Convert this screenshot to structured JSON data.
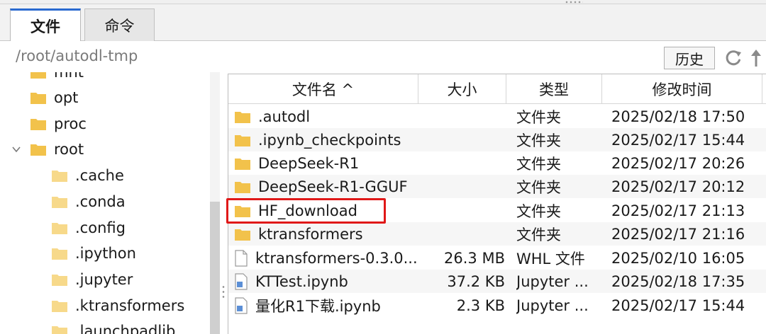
{
  "tabs": [
    {
      "label": "文件",
      "active": true
    },
    {
      "label": "命令",
      "active": false
    }
  ],
  "path": "/root/autodl-tmp",
  "history_label": "历史",
  "icons": {
    "refresh": "refresh-icon",
    "upload": "upload-arrow-icon",
    "folder": "folder-icon",
    "file": "file-icon",
    "notebook": "notebook-file-icon"
  },
  "colors": {
    "folder": "#f2c24b",
    "highlight": "#e01818",
    "accent": "#2a6ad0"
  },
  "tree": [
    {
      "label": "mnt",
      "level": 0
    },
    {
      "label": "opt",
      "level": 0
    },
    {
      "label": "proc",
      "level": 0
    },
    {
      "label": "root",
      "level": 0,
      "expanded": true
    },
    {
      "label": ".cache",
      "level": 1
    },
    {
      "label": ".conda",
      "level": 1
    },
    {
      "label": ".config",
      "level": 1
    },
    {
      "label": ".ipython",
      "level": 1
    },
    {
      "label": ".jupyter",
      "level": 1
    },
    {
      "label": ".ktransformers",
      "level": 1
    },
    {
      "label": ".launchpadlib",
      "level": 1
    }
  ],
  "columns": {
    "name": "文件名 ^",
    "size": "大小",
    "type": "类型",
    "modified": "修改时间"
  },
  "files": [
    {
      "name": ".autodl",
      "size": "",
      "type": "文件夹",
      "modified": "2025/02/18 17:50",
      "kind": "folder"
    },
    {
      "name": ".ipynb_checkpoints",
      "size": "",
      "type": "文件夹",
      "modified": "2025/02/17 15:44",
      "kind": "folder"
    },
    {
      "name": "DeepSeek-R1",
      "size": "",
      "type": "文件夹",
      "modified": "2025/02/17 20:26",
      "kind": "folder"
    },
    {
      "name": "DeepSeek-R1-GGUF",
      "size": "",
      "type": "文件夹",
      "modified": "2025/02/17 20:12",
      "kind": "folder"
    },
    {
      "name": "HF_download",
      "size": "",
      "type": "文件夹",
      "modified": "2025/02/17 21:13",
      "kind": "folder",
      "highlighted": true
    },
    {
      "name": "ktransformers",
      "size": "",
      "type": "文件夹",
      "modified": "2025/02/17 21:16",
      "kind": "folder"
    },
    {
      "name": "ktransformers-0.3.0...",
      "size": "26.3 MB",
      "type": "WHL 文件",
      "modified": "2025/02/10 16:05",
      "kind": "file"
    },
    {
      "name": "KTTest.ipynb",
      "size": "37.2 KB",
      "type": "Jupyter ...",
      "modified": "2025/02/18 17:35",
      "kind": "notebook"
    },
    {
      "name": "量化R1下载.ipynb",
      "size": "2.3 KB",
      "type": "Jupyter ...",
      "modified": "2025/02/17 15:44",
      "kind": "notebook"
    }
  ]
}
